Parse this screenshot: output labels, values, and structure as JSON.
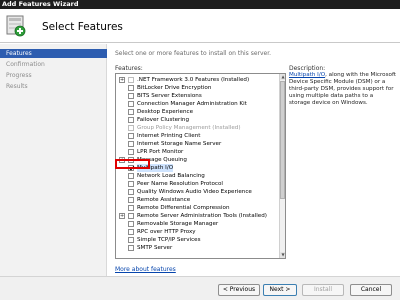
{
  "window": {
    "title": "Add Features Wizard"
  },
  "header": {
    "title": "Select Features"
  },
  "sidebar": {
    "items": [
      {
        "label": "Features",
        "active": true
      },
      {
        "label": "Confirmation",
        "active": false
      },
      {
        "label": "Progress",
        "active": false
      },
      {
        "label": "Results",
        "active": false
      }
    ]
  },
  "main": {
    "intro": "Select one or more features to install on this server.",
    "features_label": "Features:",
    "description_label": "Description:",
    "description": {
      "link": "Multipath I/O",
      "text": ", along with the Microsoft Device Specific Module (DSM) or a third-party DSM, provides support for using multiple data paths to a storage device on Windows."
    },
    "features": [
      {
        "label": ".NET Framework 3.0 Features  (Installed)",
        "expandable": true,
        "checked": false,
        "disabled": true,
        "indent": 0
      },
      {
        "label": "BitLocker Drive Encryption",
        "expandable": false,
        "checked": false,
        "disabled": false,
        "indent": 1
      },
      {
        "label": "BITS Server Extensions",
        "expandable": false,
        "checked": false,
        "disabled": false,
        "indent": 1
      },
      {
        "label": "Connection Manager Administration Kit",
        "expandable": false,
        "checked": false,
        "disabled": false,
        "indent": 1
      },
      {
        "label": "Desktop Experience",
        "expandable": false,
        "checked": false,
        "disabled": false,
        "indent": 1
      },
      {
        "label": "Failover Clustering",
        "expandable": false,
        "checked": false,
        "disabled": false,
        "indent": 1
      },
      {
        "label": "Group Policy Management  (Installed)",
        "expandable": false,
        "checked": false,
        "disabled": true,
        "indent": 1
      },
      {
        "label": "Internet Printing Client",
        "expandable": false,
        "checked": false,
        "disabled": false,
        "indent": 1
      },
      {
        "label": "Internet Storage Name Server",
        "expandable": false,
        "checked": false,
        "disabled": false,
        "indent": 1
      },
      {
        "label": "LPR Port Monitor",
        "expandable": false,
        "checked": false,
        "disabled": false,
        "indent": 1
      },
      {
        "label": "Message Queuing",
        "expandable": true,
        "checked": false,
        "disabled": false,
        "indent": 0
      },
      {
        "label": "Multipath I/O",
        "expandable": false,
        "checked": true,
        "disabled": false,
        "indent": 1,
        "selected": true
      },
      {
        "label": "Network Load Balancing",
        "expandable": false,
        "checked": false,
        "disabled": false,
        "indent": 1
      },
      {
        "label": "Peer Name Resolution Protocol",
        "expandable": false,
        "checked": false,
        "disabled": false,
        "indent": 1
      },
      {
        "label": "Quality Windows Audio Video Experience",
        "expandable": false,
        "checked": false,
        "disabled": false,
        "indent": 1
      },
      {
        "label": "Remote Assistance",
        "expandable": false,
        "checked": false,
        "disabled": false,
        "indent": 1
      },
      {
        "label": "Remote Differential Compression",
        "expandable": false,
        "checked": false,
        "disabled": false,
        "indent": 1
      },
      {
        "label": "Remote Server Administration Tools  (Installed)",
        "expandable": true,
        "checked": false,
        "disabled": false,
        "indent": 0
      },
      {
        "label": "Removable Storage Manager",
        "expandable": false,
        "checked": false,
        "disabled": false,
        "indent": 1
      },
      {
        "label": "RPC over HTTP Proxy",
        "expandable": false,
        "checked": false,
        "disabled": false,
        "indent": 1
      },
      {
        "label": "Simple TCP/IP Services",
        "expandable": false,
        "checked": false,
        "disabled": false,
        "indent": 1
      },
      {
        "label": "SMTP Server",
        "expandable": false,
        "checked": false,
        "disabled": false,
        "indent": 1
      }
    ],
    "more_link": "More about features"
  },
  "footer": {
    "previous": "< Previous",
    "next": "Next >",
    "install": "Install",
    "cancel": "Cancel"
  },
  "colors": {
    "selected_nav": "#2d5db0",
    "highlight": "#e00000",
    "link": "#0645ad"
  }
}
